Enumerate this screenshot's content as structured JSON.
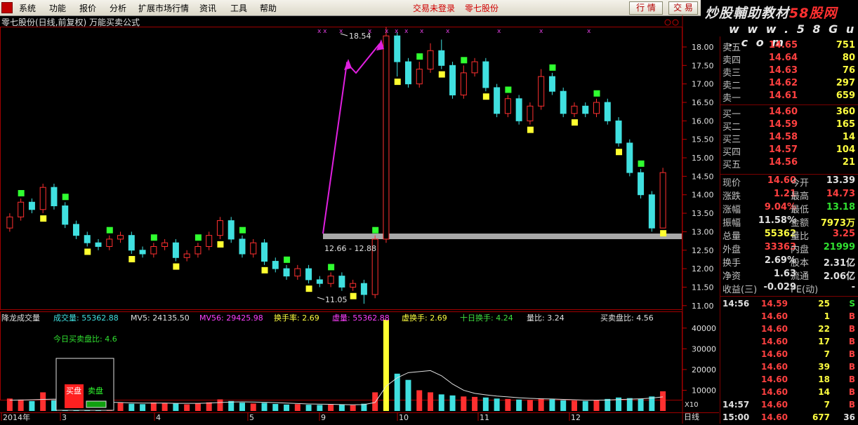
{
  "menu": [
    "系统",
    "功能",
    "报价",
    "分析",
    "扩展市场行情",
    "资讯",
    "工具",
    "帮助"
  ],
  "status": {
    "login": "交易未登录",
    "stock": "零七股份"
  },
  "buttons": {
    "quote": "行 情",
    "trade": "交 易"
  },
  "brand": {
    "title_left": "炒股輔助教材",
    "title_right": "58股网",
    "url": "w w w . 5 8 G u . c o m"
  },
  "chart_title": "零七股份(日线,前复权) 万能买卖公式",
  "colors": {
    "up": "#ff3030",
    "down": "#40e0e0",
    "buy_marker": "#30ff30",
    "sell_marker": "#ffff30",
    "line": "#e020e0",
    "axis": "#c00000"
  },
  "chart_data": [
    {
      "type": "candlestick",
      "title": "零七股份(日线,前复权) 万能买卖公式",
      "price_axis_ticks": [
        "18.00",
        "17.50",
        "17.00",
        "16.50",
        "16.00",
        "15.50",
        "15.00",
        "14.50",
        "14.00",
        "13.50",
        "13.00",
        "12.50",
        "12.00",
        "11.50",
        "11.00"
      ],
      "ylim": [
        10.92,
        18.36
      ],
      "annotations": {
        "high_label": "18.54",
        "low_label": "11.05",
        "zone_label": "12.66 - 12.88"
      },
      "x_labels": [
        "2014年",
        "3",
        "4",
        "5",
        "9",
        "10",
        "11",
        "12"
      ],
      "candles": [
        [
          13.1,
          13.4,
          13.0,
          13.5
        ],
        [
          13.4,
          13.8,
          13.3,
          13.9
        ],
        [
          13.8,
          13.6,
          13.5,
          13.9
        ],
        [
          13.6,
          14.2,
          13.5,
          14.3
        ],
        [
          14.2,
          13.7,
          13.6,
          14.3
        ],
        [
          13.7,
          13.2,
          13.1,
          13.8
        ],
        [
          13.2,
          12.9,
          12.8,
          13.3
        ],
        [
          12.9,
          12.7,
          12.6,
          13.0
        ],
        [
          12.7,
          12.6,
          12.5,
          12.8
        ],
        [
          12.6,
          12.8,
          12.5,
          12.9
        ],
        [
          12.8,
          12.9,
          12.7,
          13.0
        ],
        [
          12.9,
          12.5,
          12.4,
          13.0
        ],
        [
          12.5,
          12.4,
          12.3,
          12.6
        ],
        [
          12.4,
          12.6,
          12.3,
          12.7
        ],
        [
          12.6,
          12.7,
          12.5,
          12.8
        ],
        [
          12.7,
          12.3,
          12.2,
          12.8
        ],
        [
          12.3,
          12.4,
          12.2,
          12.5
        ],
        [
          12.4,
          12.6,
          12.3,
          12.7
        ],
        [
          12.6,
          12.9,
          12.5,
          13.0
        ],
        [
          12.9,
          13.3,
          12.8,
          13.4
        ],
        [
          13.3,
          12.8,
          12.7,
          13.4
        ],
        [
          12.8,
          12.4,
          12.3,
          12.9
        ],
        [
          12.4,
          12.7,
          12.3,
          12.8
        ],
        [
          12.7,
          12.2,
          12.1,
          12.8
        ],
        [
          12.2,
          12.0,
          11.9,
          12.3
        ],
        [
          12.0,
          11.8,
          11.7,
          12.1
        ],
        [
          11.8,
          12.0,
          11.7,
          12.1
        ],
        [
          12.0,
          11.7,
          11.6,
          12.1
        ],
        [
          11.7,
          11.6,
          11.5,
          11.8
        ],
        [
          11.6,
          11.8,
          11.5,
          11.9
        ],
        [
          11.8,
          11.5,
          11.4,
          11.9
        ],
        [
          11.5,
          11.6,
          11.4,
          11.7
        ],
        [
          11.6,
          11.3,
          11.05,
          11.7
        ],
        [
          11.3,
          12.8,
          11.2,
          12.9
        ],
        [
          12.8,
          18.3,
          12.7,
          18.54
        ],
        [
          18.3,
          17.6,
          17.2,
          18.4
        ],
        [
          17.6,
          17.0,
          16.9,
          17.7
        ],
        [
          17.0,
          17.4,
          16.9,
          17.6
        ],
        [
          17.4,
          17.9,
          17.3,
          18.1
        ],
        [
          17.9,
          17.5,
          17.4,
          18.2
        ],
        [
          17.5,
          16.7,
          16.6,
          17.6
        ],
        [
          16.7,
          17.3,
          16.6,
          17.5
        ],
        [
          17.3,
          17.6,
          17.2,
          17.7
        ],
        [
          17.6,
          16.9,
          16.8,
          17.7
        ],
        [
          16.9,
          16.2,
          16.1,
          17.0
        ],
        [
          16.2,
          16.6,
          16.1,
          16.7
        ],
        [
          16.6,
          16.0,
          15.9,
          16.7
        ],
        [
          16.0,
          16.4,
          15.9,
          16.5
        ],
        [
          16.4,
          17.2,
          16.3,
          17.4
        ],
        [
          17.2,
          16.8,
          16.7,
          17.3
        ],
        [
          16.8,
          16.2,
          16.1,
          16.9
        ],
        [
          16.2,
          16.4,
          16.1,
          16.5
        ],
        [
          16.4,
          16.2,
          16.1,
          16.5
        ],
        [
          16.2,
          16.5,
          16.1,
          16.6
        ],
        [
          16.5,
          16.0,
          15.9,
          16.6
        ],
        [
          16.0,
          15.4,
          15.3,
          16.1
        ],
        [
          15.4,
          14.6,
          14.5,
          15.5
        ],
        [
          14.6,
          14.0,
          13.9,
          14.7
        ],
        [
          14.0,
          13.1,
          13.0,
          14.1
        ],
        [
          13.1,
          14.6,
          13.1,
          14.73
        ]
      ]
    },
    {
      "type": "bar",
      "title": "降龙成交量",
      "header": [
        {
          "label": "成交量: 55362.88",
          "color": "#40e0e0"
        },
        {
          "label": "MV5: 24135.50",
          "color": "#e0e0e0"
        },
        {
          "label": "MV56: 29425.98",
          "color": "#ff40ff"
        },
        {
          "label": "换手率: 2.69",
          "color": "#ffff40"
        },
        {
          "label": "虚量: 55362.88",
          "color": "#ff40ff"
        },
        {
          "label": "虚换手: 2.69",
          "color": "#ffff40"
        },
        {
          "label": "十日换手: 4.24",
          "color": "#40e040"
        },
        {
          "label": "量比: 3.24",
          "color": "#e0e0e0"
        },
        {
          "label": "买卖盘比: 4.56",
          "color": "#e0e0e0"
        }
      ],
      "note": "今日买卖盘比: 4.6",
      "legend": {
        "buy": "买盘",
        "sell": "卖盘"
      },
      "y_ticks": [
        "40000",
        "30000",
        "20000",
        "10000"
      ],
      "unit": "X10",
      "ylim": [
        0,
        44000
      ],
      "values": [
        6000,
        5500,
        4800,
        9000,
        5200,
        4300,
        3800,
        3200,
        4000,
        3600,
        3900,
        3500,
        3300,
        4100,
        3800,
        3600,
        3200,
        3700,
        4200,
        5600,
        4800,
        4000,
        3600,
        3900,
        3400,
        3100,
        3300,
        3000,
        2900,
        3200,
        3100,
        2800,
        3500,
        9000,
        44000,
        18000,
        15000,
        10000,
        9000,
        8000,
        7500,
        7000,
        6800,
        6500,
        6000,
        5800,
        5500,
        5300,
        6000,
        5600,
        5200,
        5000,
        4800,
        5200,
        5800,
        6500,
        6200,
        5800,
        7000,
        9500
      ],
      "ma_values": [
        5200,
        5300,
        5400,
        5600,
        5700,
        5500,
        5200,
        4800,
        4400,
        4200,
        4100,
        3900,
        3800,
        3800,
        3800,
        3700,
        3700,
        3700,
        3800,
        4100,
        4300,
        4400,
        4300,
        4200,
        4000,
        3800,
        3600,
        3400,
        3300,
        3200,
        3100,
        3000,
        3100,
        4100,
        12000,
        16000,
        18500,
        19000,
        19500,
        17000,
        13000,
        10000,
        8500,
        7800,
        7200,
        6800,
        6400,
        6100,
        5900,
        5800,
        5600,
        5400,
        5200,
        5200,
        5300,
        5500,
        5700,
        5900,
        6200,
        6800
      ]
    }
  ],
  "quote": {
    "asks": [
      {
        "label": "卖五",
        "price": "14.65",
        "vol": "751"
      },
      {
        "label": "卖四",
        "price": "14.64",
        "vol": "80"
      },
      {
        "label": "卖三",
        "price": "14.63",
        "vol": "76"
      },
      {
        "label": "卖二",
        "price": "14.62",
        "vol": "297"
      },
      {
        "label": "卖一",
        "price": "14.61",
        "vol": "659"
      }
    ],
    "bids": [
      {
        "label": "买一",
        "price": "14.60",
        "vol": "360"
      },
      {
        "label": "买二",
        "price": "14.59",
        "vol": "165"
      },
      {
        "label": "买三",
        "price": "14.58",
        "vol": "14"
      },
      {
        "label": "买四",
        "price": "14.57",
        "vol": "104"
      },
      {
        "label": "买五",
        "price": "14.56",
        "vol": "21"
      }
    ],
    "stats": [
      {
        "l1": "现价",
        "v1": "14.60",
        "c1": "red",
        "l2": "今开",
        "v2": "13.39",
        "c2": "white"
      },
      {
        "l1": "涨跌",
        "v1": "1.21",
        "c1": "red",
        "l2": "最高",
        "v2": "14.73",
        "c2": "red"
      },
      {
        "l1": "涨幅",
        "v1": "9.04%",
        "c1": "red",
        "l2": "最低",
        "v2": "13.18",
        "c2": "green"
      },
      {
        "l1": "振幅",
        "v1": "11.58%",
        "c1": "white",
        "l2": "金额",
        "v2": "7973万",
        "c2": "yel"
      },
      {
        "l1": "总量",
        "v1": "55362",
        "c1": "yel",
        "l2": "量比",
        "v2": "3.25",
        "c2": "red"
      },
      {
        "l1": "外盘",
        "v1": "33363",
        "c1": "red",
        "l2": "内盘",
        "v2": "21999",
        "c2": "green"
      },
      {
        "l1": "换手",
        "v1": "2.69%",
        "c1": "white",
        "l2": "股本",
        "v2": "2.31亿",
        "c2": "white"
      },
      {
        "l1": "净资",
        "v1": "1.63",
        "c1": "white",
        "l2": "流通",
        "v2": "2.06亿",
        "c2": "white"
      },
      {
        "l1": "收益(三)",
        "v1": "-0.029",
        "c1": "white",
        "l2": "PE(动)",
        "v2": "-",
        "c2": "white"
      }
    ],
    "ticks": [
      {
        "time": "14:56",
        "price": "14.59",
        "vol": "25",
        "side": "S"
      },
      {
        "time": "",
        "price": "14.60",
        "vol": "1",
        "side": "B"
      },
      {
        "time": "",
        "price": "14.60",
        "vol": "22",
        "side": "B"
      },
      {
        "time": "",
        "price": "14.60",
        "vol": "17",
        "side": "B"
      },
      {
        "time": "",
        "price": "14.60",
        "vol": "7",
        "side": "B"
      },
      {
        "time": "",
        "price": "14.60",
        "vol": "39",
        "side": "B"
      },
      {
        "time": "",
        "price": "14.60",
        "vol": "18",
        "side": "B"
      },
      {
        "time": "",
        "price": "14.60",
        "vol": "14",
        "side": "B"
      },
      {
        "time": "14:57",
        "price": "14.60",
        "vol": "7",
        "side": "B"
      },
      {
        "time": "15:00",
        "price": "14.60",
        "vol": "677",
        "side": "36"
      }
    ]
  },
  "bottom_tab": "日线"
}
